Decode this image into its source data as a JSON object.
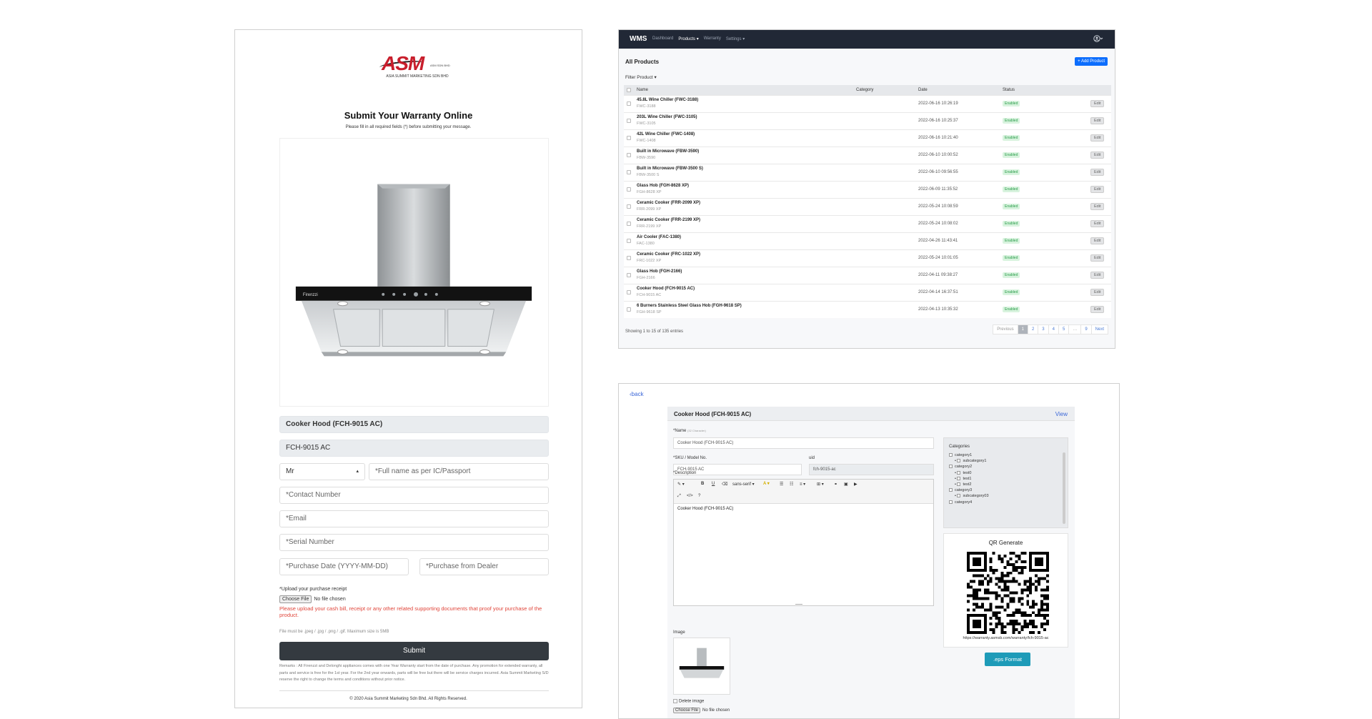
{
  "form": {
    "brand_name": "ASM",
    "brand_small": "ASM SDN BHD",
    "brand_caption": "ASIA SUMMIT MARKETING SDN BHD",
    "title": "Submit Your Warranty Online",
    "subtitle": "Please fill in all required fields (*) before submitting your message.",
    "product_name": "Cooker Hood (FCH-9015 AC)",
    "product_sku": "FCH-9015 AC",
    "salutation": "Mr",
    "fullname_placeholder": "*Full name as per IC/Passport",
    "contact_placeholder": "*Contact Number",
    "email_placeholder": "*Email",
    "serial_placeholder": "*Serial Number",
    "purchase_date_placeholder": "*Purchase Date (YYYY-MM-DD)",
    "dealer_placeholder": "*Purchase from Dealer",
    "upload_label": "*Upload your purchase receipt",
    "choose_file": "Choose File",
    "no_file": "No file chosen",
    "warning": "Please upload your cash bill, receipt or any other related supporting documents that proof your purchase of the product.",
    "file_hint": "File must be .jpeg / .jpg / .png / .gif. Maximum size is 5MB",
    "submit": "Submit",
    "remarks": "Remarks : All Firenzzi and Delonghi appliances comes with one Year Warranty start from the date of purchase. Any promotion for extended warranty, all parts and service is free for the 1st year. For the 2nd year onwards, parts will be free but there will be service charges incurred. Asia Summit Marketing S/D reserve the right to change the terms and conditions without prior notice.",
    "copyright": "© 2020 Asia Summit Marketing Sdn Bhd. All Rights Reserved.",
    "hood_brand": "Firenzzi"
  },
  "list": {
    "brand": "WMS",
    "nav": [
      "Dashboard",
      "Products ▾",
      "Warranty",
      "Settings ▾"
    ],
    "title": "All Products",
    "add_button": "+ Add Product",
    "filter": "Filter Product ▾",
    "columns": {
      "name": "Name",
      "category": "Category",
      "date": "Date",
      "status": "Status"
    },
    "edit_label": "Edit",
    "rows": [
      {
        "name": "45.8L Wine Chiller (FWC-3188)",
        "sku": "FWC-3188",
        "date": "2022-06-16 10:26:19",
        "status": "Enabled"
      },
      {
        "name": "203L Wine Chiller (FWC-3105)",
        "sku": "FWC-3105",
        "date": "2022-06-16 10:25:37",
        "status": "Enabled"
      },
      {
        "name": "42L Wine Chiller (FWC-1408)",
        "sku": "FWC-1408",
        "date": "2022-06-16 10:21:40",
        "status": "Enabled"
      },
      {
        "name": "Built in Microwave (FBW-3590)",
        "sku": "FBW-3590",
        "date": "2022-06-10 10:00:52",
        "status": "Enabled"
      },
      {
        "name": "Built in Microwave (FBW-3500 S)",
        "sku": "FBW-3500 S",
        "date": "2022-06-10 09:56:55",
        "status": "Enabled"
      },
      {
        "name": "Glass Hob (FGH-8628 XP)",
        "sku": "FGH-8628 XP",
        "date": "2022-06-09 11:35:52",
        "status": "Enabled"
      },
      {
        "name": "Ceramic Cooker (FRR-2099 XP)",
        "sku": "FRR-2099 XP",
        "date": "2022-05-24 10:08:59",
        "status": "Enabled"
      },
      {
        "name": "Ceramic Cooker (FRR-2199 XP)",
        "sku": "FRR-2199 XP",
        "date": "2022-05-24 10:08:02",
        "status": "Enabled"
      },
      {
        "name": "Air Cooler (FAC-1380)",
        "sku": "FAC-1380",
        "date": "2022-04-26 11:43:41",
        "status": "Enabled"
      },
      {
        "name": "Ceramic Cooker (FRC-1022 XP)",
        "sku": "FRC-1022 XP",
        "date": "2022-05-24 10:01:05",
        "status": "Enabled"
      },
      {
        "name": "Glass Hob (FGH-2166)",
        "sku": "FGH-2166",
        "date": "2022-04-11 09:38:27",
        "status": "Enabled"
      },
      {
        "name": "Cooker Hood (FCH-9015 AC)",
        "sku": "FCH-9015 AC",
        "date": "2022-04-14 16:37:51",
        "status": "Enabled"
      },
      {
        "name": "6 Burners Stainless Steel Glass Hob (FGH-9618 SP)",
        "sku": "FGH-9618 SP",
        "date": "2022-04-13 10:35:32",
        "status": "Enabled"
      }
    ],
    "showing": "Showing 1 to 15 of 135 entries",
    "pager": [
      "Previous",
      "1",
      "2",
      "3",
      "4",
      "5",
      "…",
      "9",
      "Next"
    ]
  },
  "edit": {
    "back": "back",
    "title": "Cooker Hood (FCH-9015 AC)",
    "view": "View",
    "name_label": "*Name",
    "name_hint": "(32 Character)",
    "name_value": "Cooker Hood (FCH-9015 AC)",
    "sku_label": "*SKU / Model No.",
    "sku_value": "FCH-9015 AC",
    "uid_label": "uid",
    "uid_value": "fch-9015-ac",
    "desc_label": "*Description",
    "desc_value": "Cooker Hood (FCH-9015 AC)",
    "font_select": "sans-serif",
    "image_label": "Image",
    "delete_image": "Delete image",
    "choose_file": "Choose File",
    "no_file": "No file chosen",
    "categories_title": "Categories",
    "categories": [
      {
        "label": "category1",
        "level": 0
      },
      {
        "label": "subcategory1",
        "level": 1
      },
      {
        "label": "category2",
        "level": 0
      },
      {
        "label": "test0",
        "level": 1
      },
      {
        "label": "test1",
        "level": 1
      },
      {
        "label": "test2",
        "level": 1
      },
      {
        "label": "category3",
        "level": 0
      },
      {
        "label": "subcategory03",
        "level": 1
      },
      {
        "label": "category4",
        "level": 0
      }
    ],
    "qr_title": "QR Generate",
    "qr_url": "https://warranty.asmsb.com/warranty/fch-9015-ac",
    "eps_button": ".eps Format"
  },
  "colors": {
    "brand_red": "#c81e2c",
    "navbar": "#212836",
    "primary": "#0d6efd",
    "submit": "#343a40",
    "eps": "#1e9bb8",
    "enabled": "#2a9d4a",
    "warning": "#e0453a"
  },
  "icons": [
    "user-circle-icon",
    "chevron-left-icon",
    "checkbox-icon",
    "qr-code-icon",
    "cooker-hood-image"
  ]
}
